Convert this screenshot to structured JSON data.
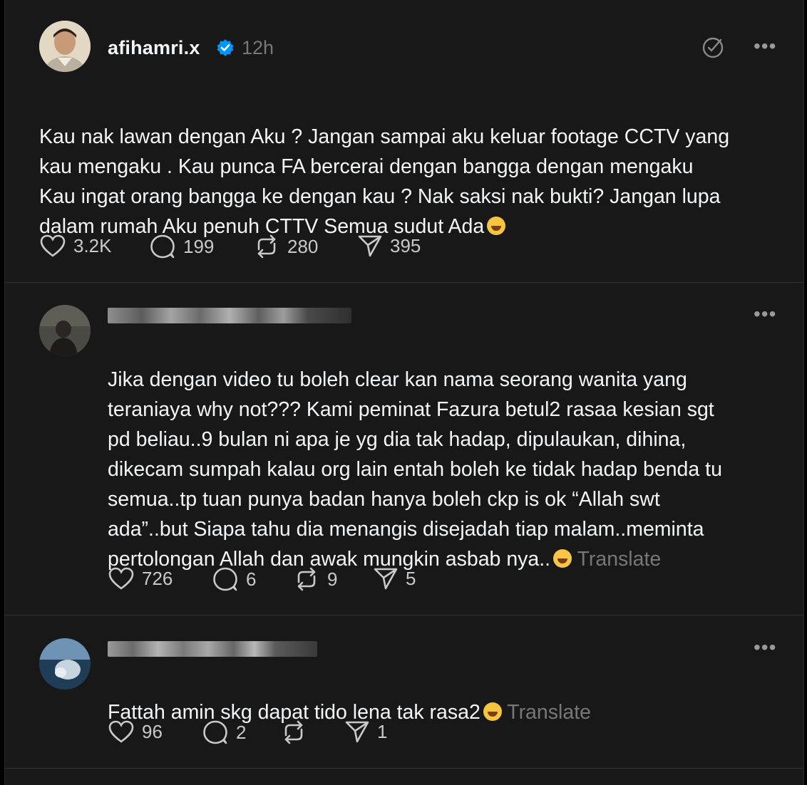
{
  "post": {
    "username": "afihamri.x",
    "time": "12h",
    "text": "Kau nak lawan dengan Aku ? Jangan sampai aku keluar footage CCTV yang\nkau mengaku . Kau punca FA bercerai dengan bangga dengan mengaku\nKau ingat orang bangga ke dengan kau ? Nak saksi nak bukti? Jangan lupa\ndalam rumah Aku penuh CTTV Semua sudut Ada",
    "emoji": "rolling-on-floor-laughing",
    "likes": "3.2K",
    "replies": "199",
    "reposts": "280",
    "shares": "395"
  },
  "replies": [
    {
      "text": "Jika dengan video tu boleh clear kan nama seorang wanita yang\nteraniaya why not??? Kami peminat Fazura betul2 rasaa kesian sgt\npd beliau..9 bulan ni apa je yg dia tak hadap, dipulaukan, dihina,\ndikecam sumpah kalau org lain entah boleh ke tidak hadap benda tu\nsemua..tp tuan punya badan hanya boleh ckp is ok “Allah swt\nada”..but Siapa tahu dia menangis disejadah tiap malam..meminta\npertolongan Allah dan awak mungkin asbab nya..",
      "emoji": "crying-face",
      "translate": "Translate",
      "likes": "726",
      "replies": "6",
      "reposts": "9",
      "shares": "5"
    },
    {
      "text": "Fattah amin skg dapat tido lena tak rasa2",
      "emoji": "rolling-on-floor-laughing",
      "translate": "Translate",
      "likes": "96",
      "replies": "2",
      "reposts": "",
      "shares": "1"
    }
  ],
  "icons": {
    "verified": "verified-badge-icon",
    "like": "heart-icon",
    "reply": "comment-bubble-icon",
    "repost": "repost-icon",
    "share": "send-icon",
    "more": "more-dots-icon",
    "muted": "mute-icon"
  },
  "colors": {
    "background": "#181818",
    "text": "#f3f5f7",
    "muted": "#777777",
    "verified": "#0095f6"
  }
}
